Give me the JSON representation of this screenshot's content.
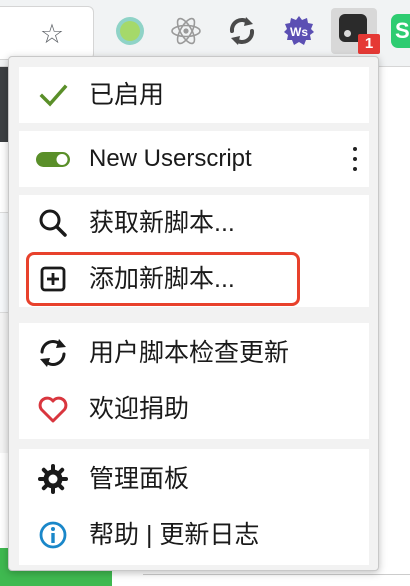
{
  "toolbar": {
    "extensions": [
      {
        "icon": "green-circle-extension-icon"
      },
      {
        "icon": "react-extension-icon"
      },
      {
        "icon": "sync-extension-icon"
      },
      {
        "icon": "ws-extension-icon",
        "text": "Ws"
      },
      {
        "icon": "tampermonkey-icon"
      },
      {
        "icon": "s-extension-icon",
        "text": "S"
      }
    ],
    "badge_count": "1"
  },
  "menu": {
    "enabled_label": "已启用",
    "script": {
      "name": "New Userscript",
      "enabled": true
    },
    "get_scripts_label": "获取新脚本...",
    "add_script_label": "添加新脚本...",
    "check_updates_label": "用户脚本检查更新",
    "donate_label": "欢迎捐助",
    "dashboard_label": "管理面板",
    "help_label": "帮助 | 更新日志"
  },
  "colors": {
    "accent_green": "#5a8f29",
    "heart_red": "#d9363e",
    "info_blue": "#1a87c9",
    "highlight_red": "#e8412c",
    "badge_red": "#e53935"
  }
}
